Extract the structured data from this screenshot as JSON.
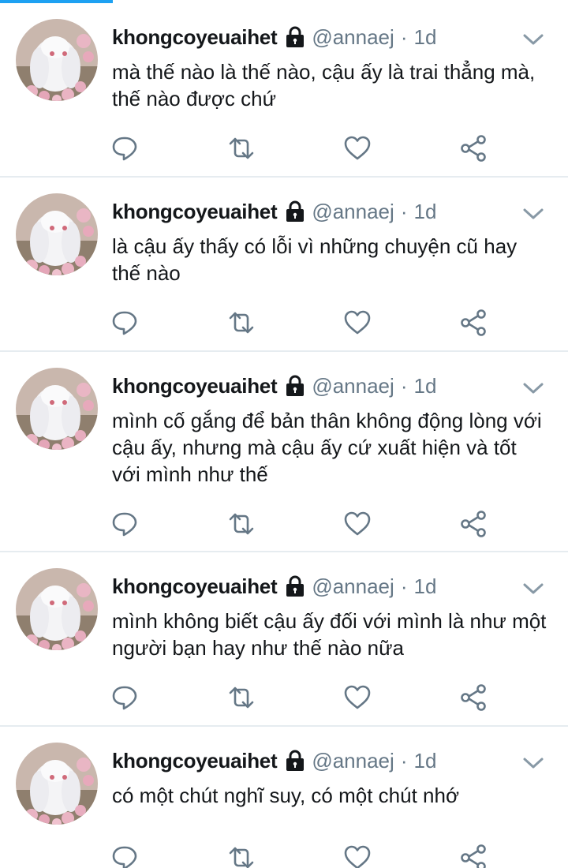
{
  "colors": {
    "accent": "#1da1f2",
    "text": "#14171a",
    "muted": "#657786",
    "divider": "#e6ecf0"
  },
  "icons": {
    "lock": "lock-icon",
    "menu": "chevron-down-icon",
    "reply": "reply-icon",
    "retweet": "retweet-icon",
    "like": "heart-icon",
    "share": "share-icon"
  },
  "tweets": [
    {
      "display_name": "khongcoyeuaihet",
      "handle": "@annaej",
      "separator": "·",
      "time": "1d",
      "text": "mà thế nào là thế nào, cậu ấy là trai thẳng mà, thế nào được chứ"
    },
    {
      "display_name": "khongcoyeuaihet",
      "handle": "@annaej",
      "separator": "·",
      "time": "1d",
      "text": "là cậu ấy thấy có lỗi vì những chuyện cũ hay thế nào"
    },
    {
      "display_name": "khongcoyeuaihet",
      "handle": "@annaej",
      "separator": "·",
      "time": "1d",
      "text": "mình cố gắng để bản thân không động lòng với cậu ấy, nhưng mà cậu ấy cứ xuất hiện và tốt với mình như thế"
    },
    {
      "display_name": "khongcoyeuaihet",
      "handle": "@annaej",
      "separator": "·",
      "time": "1d",
      "text": "mình không biết cậu ấy đối với mình là như một người bạn hay như thế nào nữa"
    },
    {
      "display_name": "khongcoyeuaihet",
      "handle": "@annaej",
      "separator": "·",
      "time": "1d",
      "text": "có một chút nghĩ suy, có một chút nhớ"
    }
  ]
}
